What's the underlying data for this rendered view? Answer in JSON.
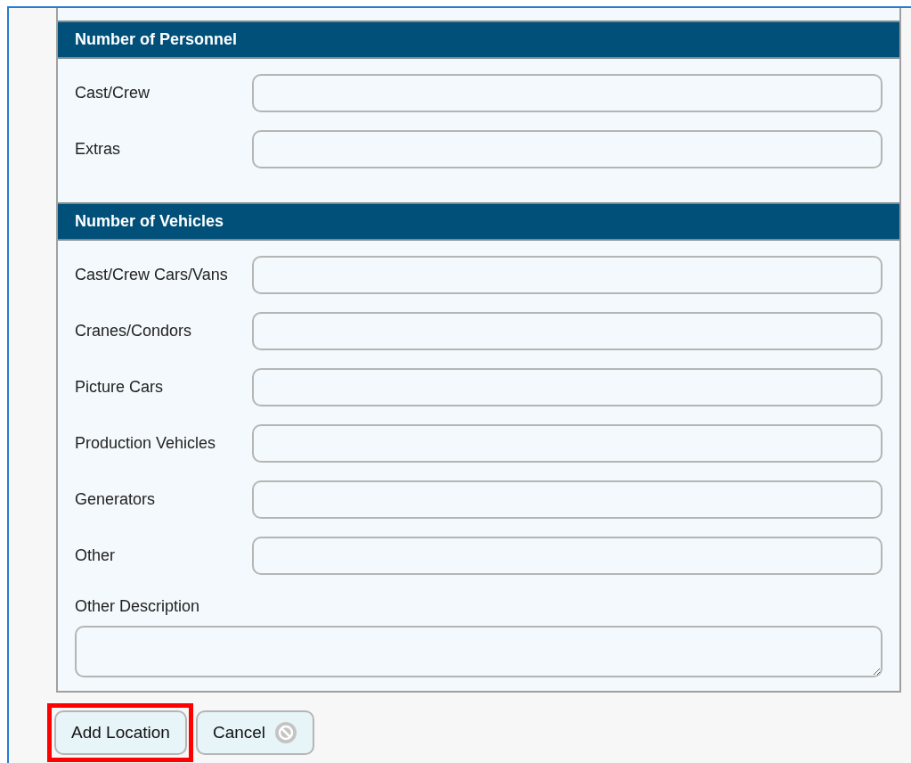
{
  "sections": [
    {
      "title": "Number of Personnel",
      "fields": [
        {
          "label": "Cast/Crew",
          "kind": "input"
        },
        {
          "label": "Extras",
          "kind": "input"
        }
      ]
    },
    {
      "title": "Number of Vehicles",
      "fields": [
        {
          "label": "Cast/Crew Cars/Vans",
          "kind": "input"
        },
        {
          "label": "Cranes/Condors",
          "kind": "input"
        },
        {
          "label": "Picture Cars",
          "kind": "input"
        },
        {
          "label": "Production Vehicles",
          "kind": "input"
        },
        {
          "label": "Generators",
          "kind": "input"
        },
        {
          "label": "Other",
          "kind": "input"
        },
        {
          "label": "Other Description",
          "kind": "textarea"
        }
      ]
    }
  ],
  "buttons": [
    {
      "label": "Add Location",
      "kind": "submit",
      "highlighted": true
    },
    {
      "label": "Cancel",
      "kind": "cancel",
      "highlighted": false
    }
  ]
}
